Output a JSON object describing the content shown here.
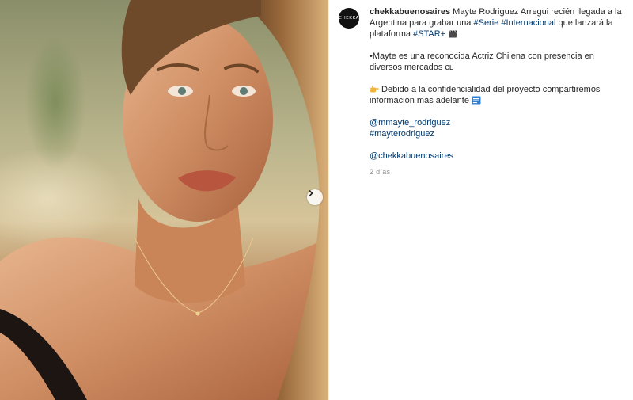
{
  "post": {
    "account": {
      "avatar_text": "CHEKKA",
      "username": "chekkabuenosaires"
    },
    "caption": {
      "line1_text": " Mayte Rodriguez Arregui recién llegada a la Argentina para grabar una ",
      "tag_serie": "#Serie",
      "space": " ",
      "tag_internacional": "#Internacional",
      "line1_text_b": " que lanzará la plataforma ",
      "tag_star": "#STAR+",
      "para2": "•Mayte es una reconocida Actriz Chilena con presencia en diversos mercados ᴄʟ",
      "para3": " Debido a la confidencialidad del proyecto compartiremos información más adelante ",
      "mention1": "@mmayte_rodriguez",
      "hashtag_mayte": "#mayterodriguez",
      "mention2": "@chekkabuenosaires"
    },
    "timestamp": "2 días"
  },
  "icons": {
    "next": "chevron-right-icon",
    "clapper": "clapperboard-emoji",
    "point": "pointing-hand-emoji",
    "info": "info-emoji"
  }
}
